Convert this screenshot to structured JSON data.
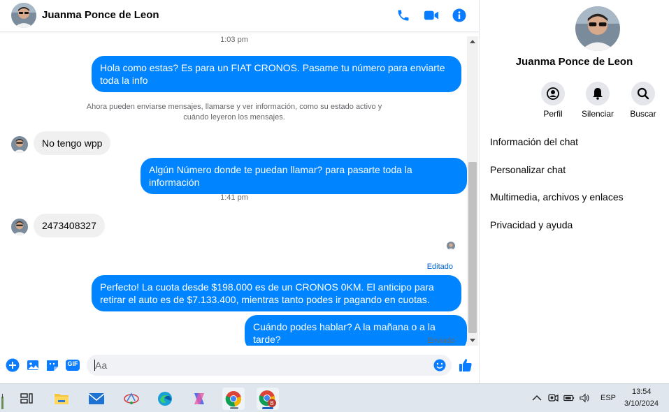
{
  "contact": {
    "name": "Juanma Ponce de Leon"
  },
  "header": {
    "icons": [
      "phone-icon",
      "video-camera-icon",
      "info-icon"
    ]
  },
  "messages": {
    "time_1": "1:03 pm",
    "out_1": "Hola como estas?  Es para un FIAT CRONOS. Pasame tu número para enviarte toda la info",
    "system_note": "Ahora pueden enviarse mensajes, llamarse y ver información, como su estado activo y cuándo leyeron los mensajes.",
    "in_1": "No tengo wpp",
    "out_2": "Algún Número donde te puedan llamar? para pasarte toda la información",
    "time_2": "1:41 pm",
    "in_2": "2473408327",
    "edited_label": "Editado",
    "out_3": "Perfecto! La cuota desde $198.000 es de un CRONOS 0KM. El anticipo para retirar el auto es de $7.133.400, mientras tanto podes ir pagando en cuotas.",
    "out_4": "Cuándo podes hablar? A la mañana o a la tarde?",
    "status": "Enviado"
  },
  "composer": {
    "placeholder": "Aa",
    "icons": [
      "plus-icon",
      "image-icon",
      "sticker-icon",
      "gif-icon",
      "emoji-icon",
      "like-icon"
    ],
    "gif_label": "GIF"
  },
  "info_panel": {
    "actions": [
      {
        "label": "Perfil",
        "icon": "profile-icon"
      },
      {
        "label": "Silenciar",
        "icon": "bell-icon"
      },
      {
        "label": "Buscar",
        "icon": "search-icon"
      }
    ],
    "menu": [
      "Información del chat",
      "Personalizar chat",
      "Multimedia, archivos y enlaces",
      "Privacidad y ayuda"
    ]
  },
  "taskbar": {
    "apps": [
      "task-view-icon",
      "file-explorer-icon",
      "mail-icon",
      "paint-icon",
      "edge-icon",
      "copilot-icon",
      "chrome-icon",
      "chrome-profile-icon"
    ],
    "language": "ESP",
    "time": "13:54",
    "date": "3/10/2024"
  },
  "colors": {
    "accent": "#0084ff",
    "bubble_in": "#f0f0f0",
    "icon_blue": "#0a7cff"
  }
}
